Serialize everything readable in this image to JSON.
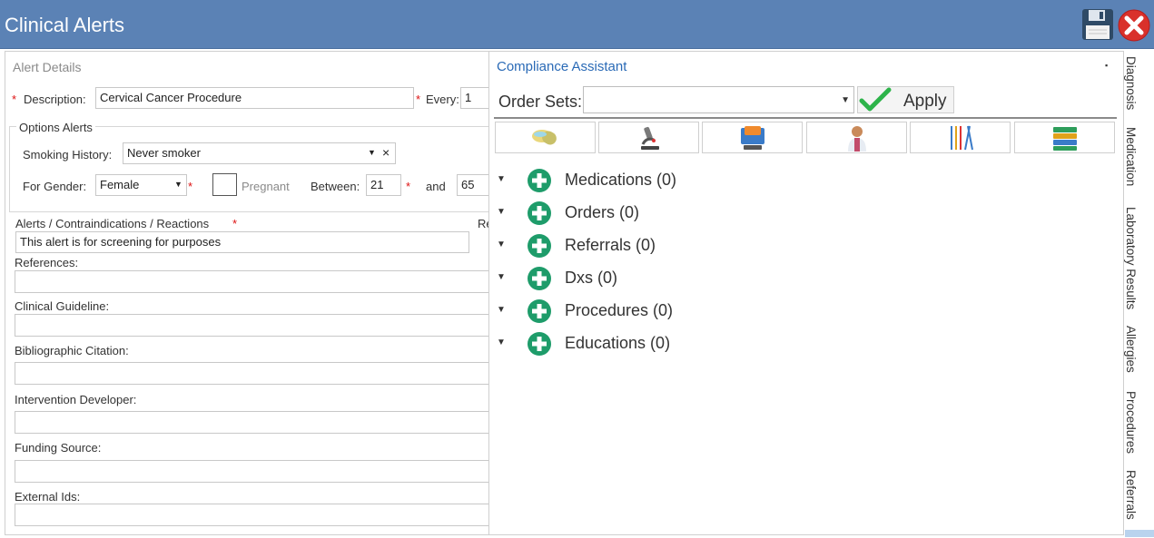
{
  "window": {
    "title": "Clinical Alerts"
  },
  "alert_details": {
    "section_title": "Alert Details",
    "description_label": "Description:",
    "description_value": "Cervical Cancer Procedure",
    "every_label": "Every:",
    "every_value": "1",
    "options_title": "Options Alerts",
    "smoking_label": "Smoking History:",
    "smoking_value": "Never smoker",
    "gender_label": "For Gender:",
    "gender_value": "Female",
    "pregnant_label": "Pregnant",
    "between_label": "Between:",
    "age_from": "21",
    "and_label": "and",
    "age_to": "65",
    "alerts_label": "Alerts / Contraindications / Reactions",
    "alerts_value": "This alert is for screening for purposes",
    "truncated_right": "Re",
    "references_label": "References:",
    "guideline_label": "Clinical Guideline:",
    "citation_label": "Bibliographic Citation:",
    "developer_label": "Intervention Developer:",
    "funding_label": "Funding Source:",
    "external_label": "External Ids:",
    "required_mark": "*"
  },
  "compliance": {
    "title": "Compliance Assistant",
    "order_sets_label": "Order Sets:",
    "order_sets_value": "",
    "apply_label": "Apply",
    "toolbar_icons": [
      "medication-icon",
      "microscope-icon",
      "monitor-icon",
      "doctor-icon",
      "surgical-tools-icon",
      "books-icon"
    ],
    "categories": [
      {
        "label": "Medications (0)"
      },
      {
        "label": "Orders (0)"
      },
      {
        "label": "Referrals (0)"
      },
      {
        "label": "Dxs (0)"
      },
      {
        "label": "Procedures (0)"
      },
      {
        "label": "Educations (0)"
      }
    ]
  },
  "side_tabs": [
    "Diagnosis",
    "Medication",
    "Laboratory Results",
    "Allergies",
    "Procedures",
    "Referrals"
  ],
  "colors": {
    "titlebar": "#5b82b5",
    "accent_blue": "#2a6ab6",
    "plus_green": "#1e9c6a",
    "required": "#dd1111"
  }
}
